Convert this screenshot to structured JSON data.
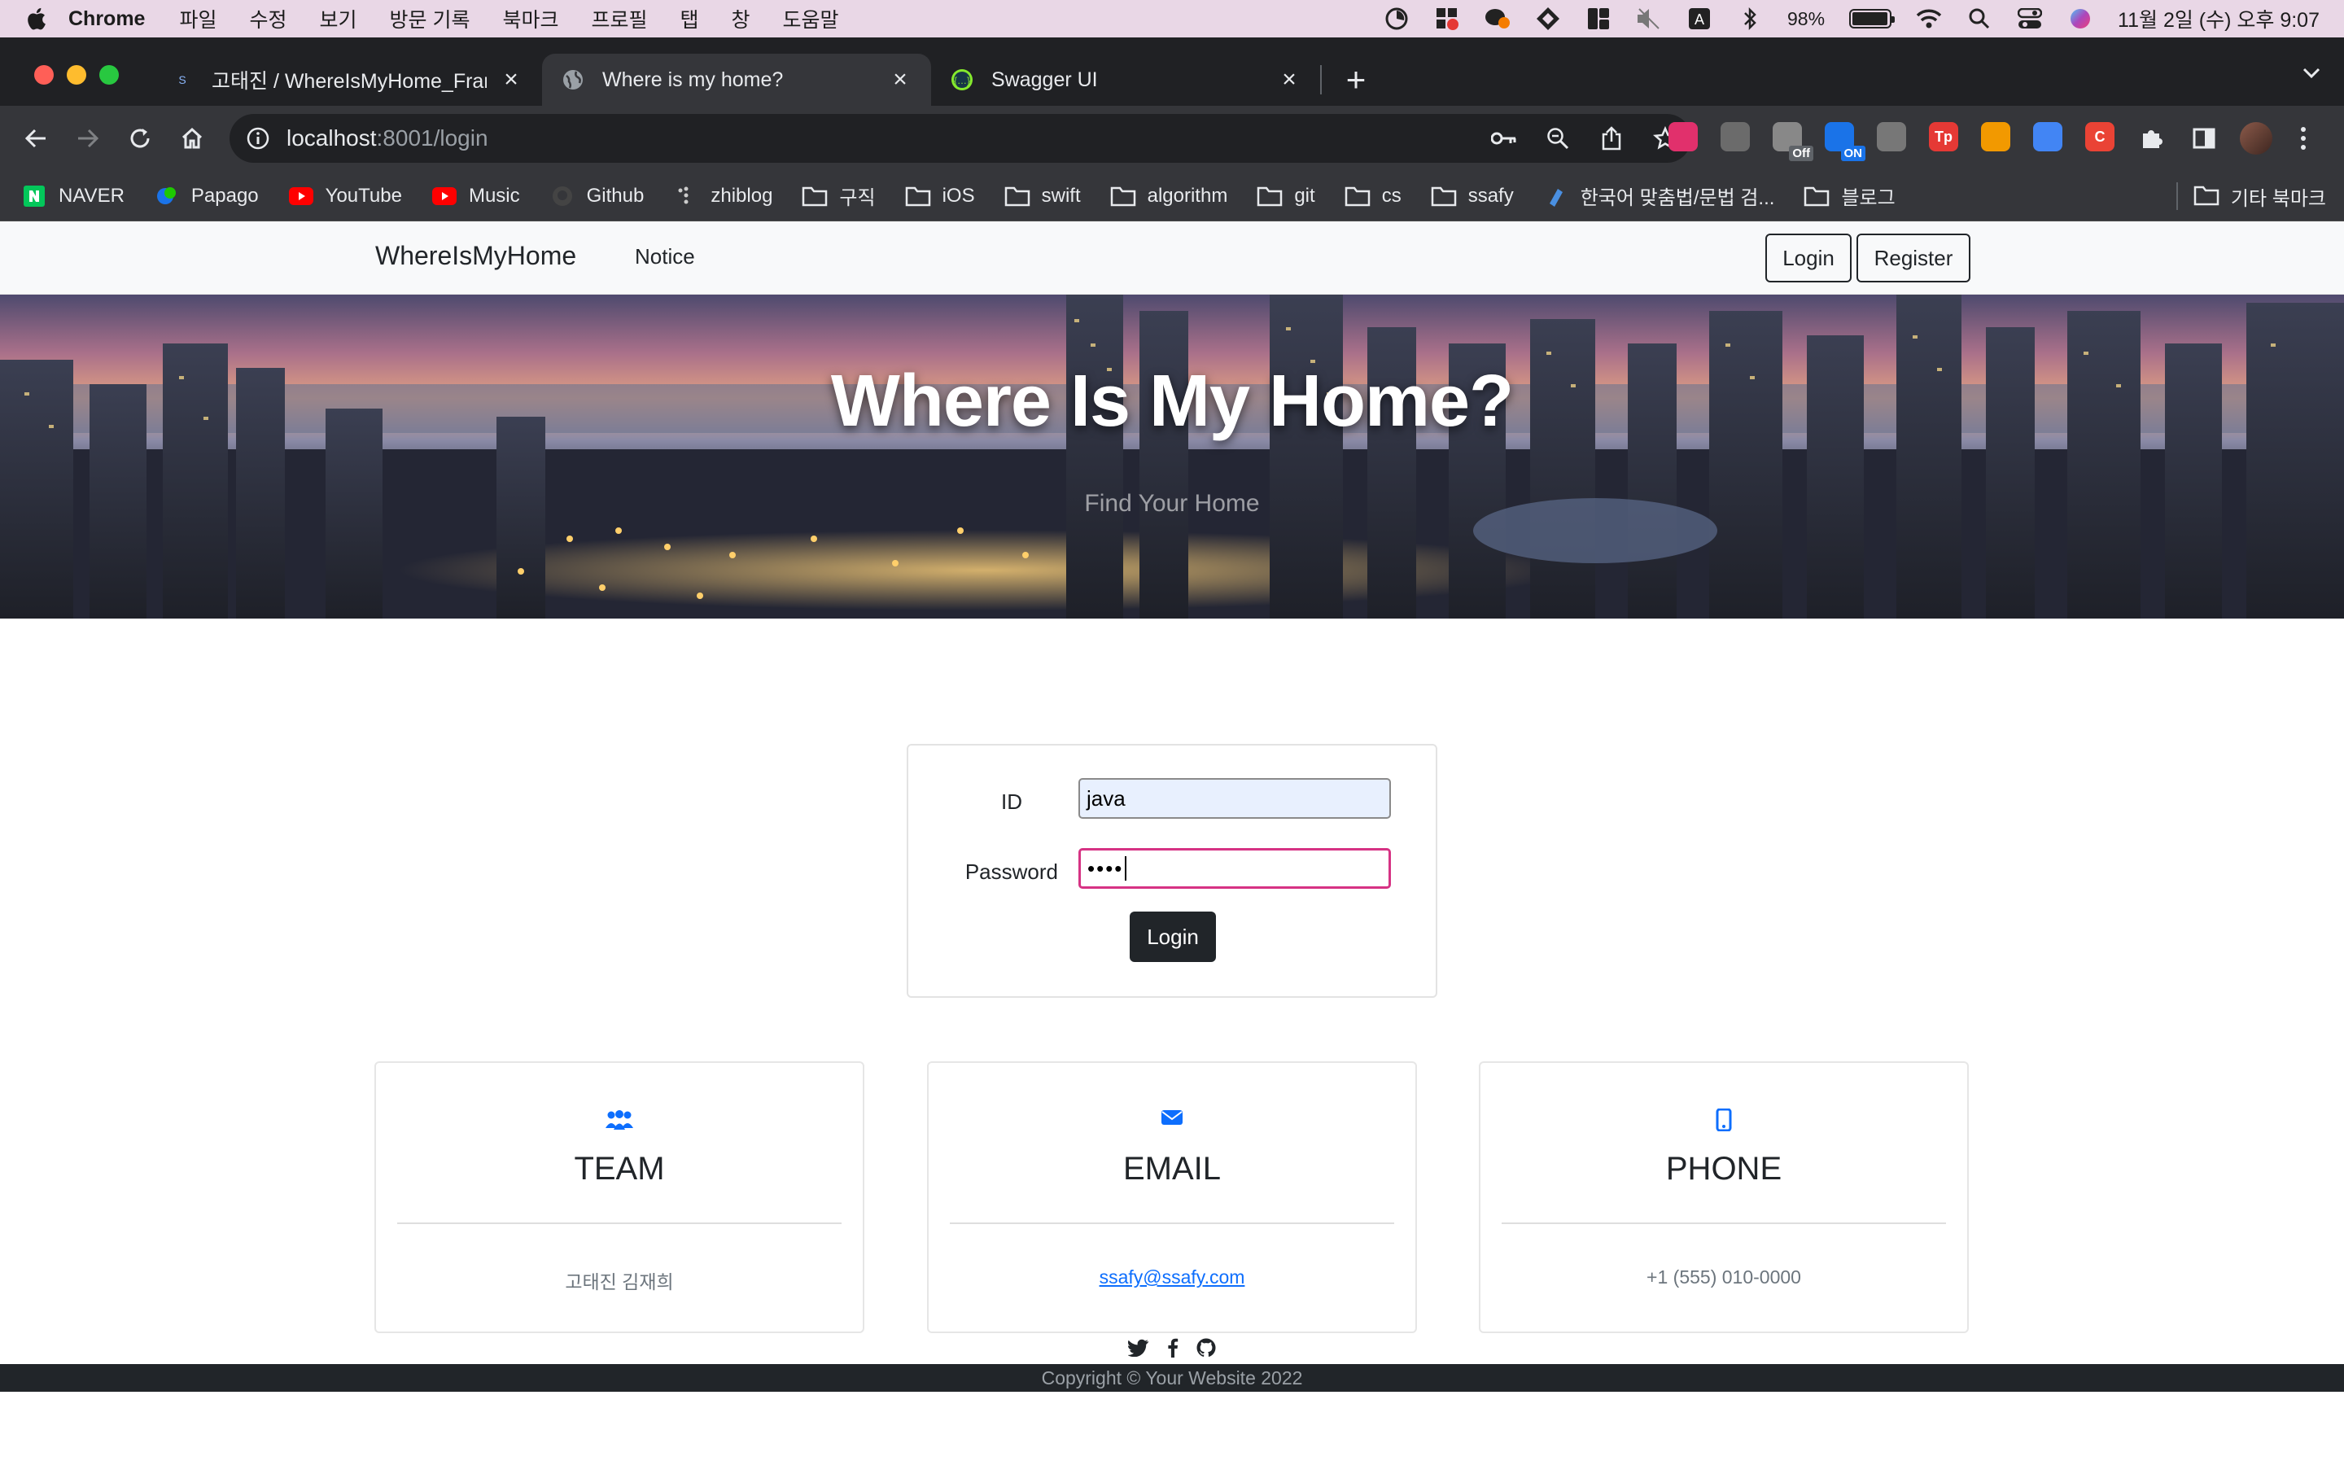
{
  "menubar": {
    "app_name": "Chrome",
    "items": [
      "파일",
      "수정",
      "보기",
      "방문 기록",
      "북마크",
      "프로필",
      "탭",
      "창",
      "도움말"
    ],
    "battery_percent": "98%",
    "battery_level": 0.98,
    "clock": "11월 2일 (수) 오후 9:07"
  },
  "tabs": [
    {
      "title": "고태진 / WhereIsMyHome_Framework",
      "active": false,
      "favicon": "ssafy-icon"
    },
    {
      "title": "Where is my home?",
      "active": true,
      "favicon": "globe-icon"
    },
    {
      "title": "Swagger UI",
      "active": false,
      "favicon": "swagger-icon"
    }
  ],
  "toolbar": {
    "url_host": "localhost",
    "url_rest": ":8001/login",
    "extensions": [
      {
        "name": "instagram-ext-icon",
        "color": "#e1306c",
        "label": ""
      },
      {
        "name": "ext-gray-icon",
        "color": "#6b6b6b",
        "label": ""
      },
      {
        "name": "ext-off-icon",
        "color": "#888888",
        "label": "",
        "badge": "Off"
      },
      {
        "name": "ext-on-icon",
        "color": "#1a73e8",
        "label": "",
        "badge": "ON"
      },
      {
        "name": "ext-camera-icon",
        "color": "#777777",
        "label": ""
      },
      {
        "name": "ext-tp-icon",
        "color": "#e53935",
        "label": "Tp"
      },
      {
        "name": "ext-orange-icon",
        "color": "#f29900",
        "label": ""
      },
      {
        "name": "ext-blue-icon",
        "color": "#4285f4",
        "label": ""
      },
      {
        "name": "ext-c-icon",
        "color": "#ea4335",
        "label": "C"
      }
    ]
  },
  "bookmarks": [
    {
      "label": "NAVER",
      "icon": "naver-icon",
      "color": "#03c75a"
    },
    {
      "label": "Papago",
      "icon": "papago-icon",
      "color": "#1ec800"
    },
    {
      "label": "YouTube",
      "icon": "youtube-icon",
      "color": "#ff0000"
    },
    {
      "label": "Music",
      "icon": "youtube-music-icon",
      "color": "#ff0000"
    },
    {
      "label": "Github",
      "icon": "github-icon",
      "color": "#333333"
    },
    {
      "label": "zhiblog",
      "icon": "zhiblog-icon",
      "color": "#cccccc"
    },
    {
      "label": "구직",
      "icon": "folder-icon",
      "color": "#e8eaed"
    },
    {
      "label": "iOS",
      "icon": "folder-icon",
      "color": "#e8eaed"
    },
    {
      "label": "swift",
      "icon": "folder-icon",
      "color": "#e8eaed"
    },
    {
      "label": "algorithm",
      "icon": "folder-icon",
      "color": "#e8eaed"
    },
    {
      "label": "git",
      "icon": "folder-icon",
      "color": "#e8eaed"
    },
    {
      "label": "cs",
      "icon": "folder-icon",
      "color": "#e8eaed"
    },
    {
      "label": "ssafy",
      "icon": "folder-icon",
      "color": "#e8eaed"
    },
    {
      "label": "한국어 맞춤법/문법 검...",
      "icon": "spellcheck-icon",
      "color": "#4a90e2"
    },
    {
      "label": "블로그",
      "icon": "folder-icon",
      "color": "#e8eaed"
    }
  ],
  "bookmarks_other": "기타 북마크",
  "site": {
    "brand": "WhereIsMyHome",
    "nav_notice": "Notice",
    "btn_login": "Login",
    "btn_register": "Register",
    "hero_title": "Where Is My Home?",
    "hero_subtitle": "Find Your Home",
    "form": {
      "id_label": "ID",
      "id_value": "java",
      "password_label": "Password",
      "password_value": "••••",
      "submit_label": "Login"
    },
    "cards": [
      {
        "icon": "team-icon",
        "title": "TEAM",
        "text": "고태진 김재희"
      },
      {
        "icon": "envelope-icon",
        "title": "EMAIL",
        "text": "ssafy@ssafy.com"
      },
      {
        "icon": "phone-icon",
        "title": "PHONE",
        "text": "+1 (555) 010-0000"
      }
    ],
    "footer": "Copyright © Your Website 2022",
    "accent_color": "#0d6efd"
  }
}
